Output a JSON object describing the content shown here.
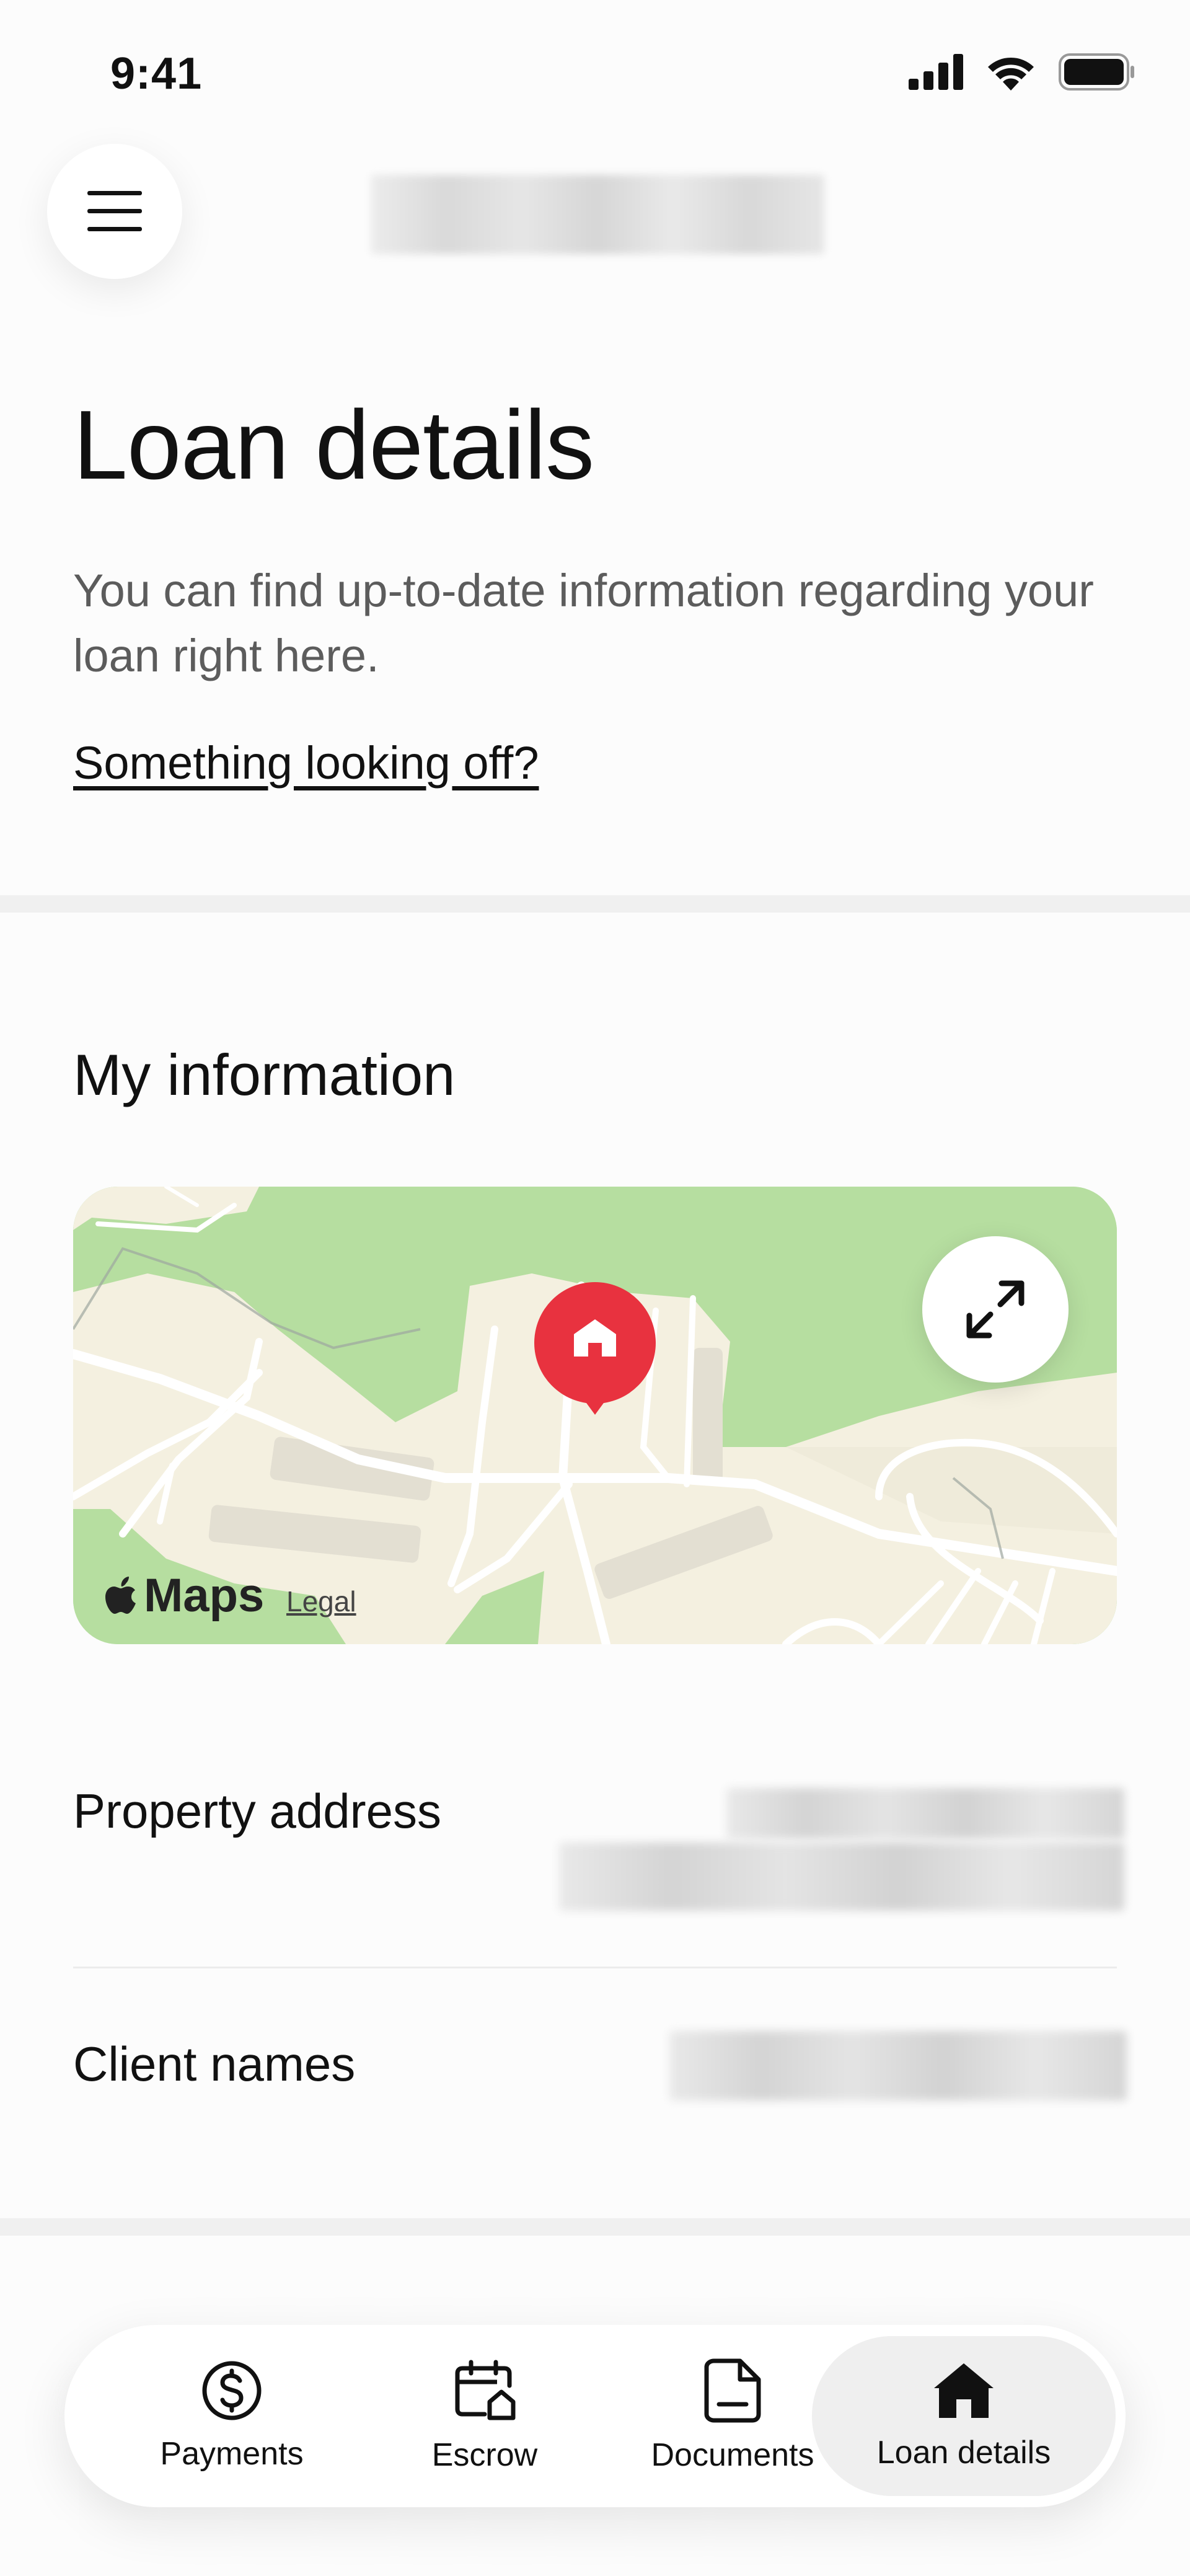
{
  "status_bar": {
    "time": "9:41"
  },
  "header": {
    "title": "Loan details",
    "description": "You can find up-to-date information regarding your loan right here.",
    "help_link": "Something looking off?"
  },
  "my_information": {
    "title": "My information",
    "map": {
      "brand": "Maps",
      "legal": "Legal",
      "pin_icon": "home-pin-icon",
      "expand_icon": "expand-icon"
    },
    "rows": [
      {
        "label": "Property address"
      },
      {
        "label": "Client names"
      }
    ]
  },
  "bottom_nav": {
    "items": [
      {
        "label": "Payments",
        "icon": "dollar-circle-icon"
      },
      {
        "label": "Escrow",
        "icon": "calendar-home-icon"
      },
      {
        "label": "Documents",
        "icon": "document-icon"
      },
      {
        "label": "Loan details",
        "icon": "home-icon",
        "active": true
      }
    ]
  },
  "colors": {
    "accent_pin": "#e8323f",
    "map_green": "#b6dea0",
    "map_land": "#f4f0e0",
    "background": "#fcfcfc"
  }
}
